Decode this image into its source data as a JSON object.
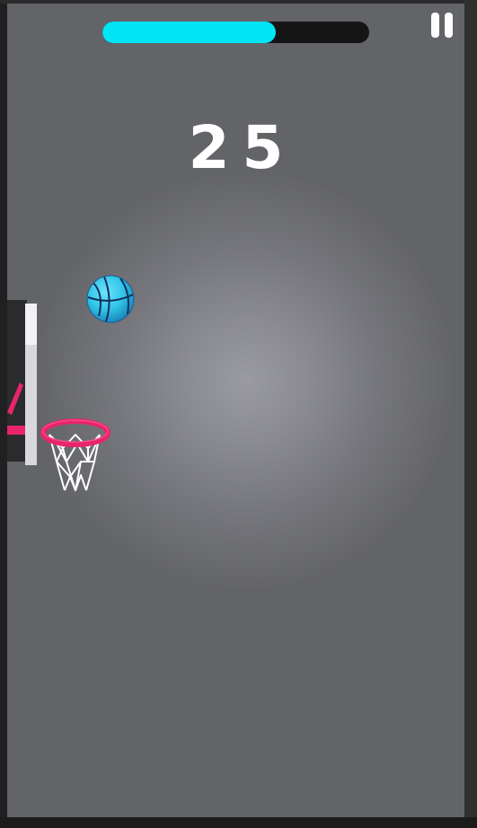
{
  "game": {
    "score": "25",
    "shot_timer": {
      "progress": 0.65,
      "fill_color": "#00e5f6",
      "track_color": "#151515"
    },
    "pause": {
      "icon": "pause-icon",
      "color": "#ffffff"
    },
    "basketball": {
      "icon": "basketball-icon",
      "color": "#2fc4e8"
    },
    "hoop": {
      "rim_color": "#e8246b",
      "net_color": "#ffffff",
      "backboard_color": "#d9d9dc"
    },
    "background_color": "#7a7b80"
  }
}
